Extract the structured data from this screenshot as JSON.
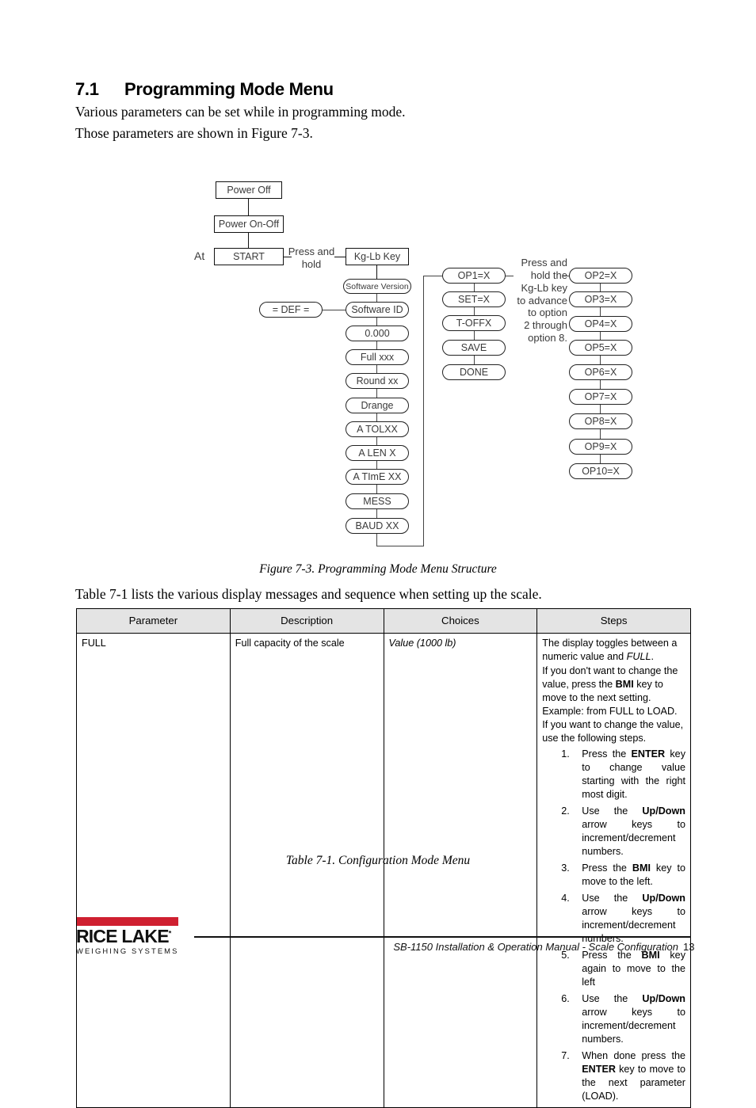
{
  "section": {
    "number": "7.1",
    "title": "Programming Mode Menu",
    "intro_line1": "Various parameters can be set while in programming mode.",
    "intro_line2": "Those parameters are shown in Figure 7-3."
  },
  "figure": {
    "caption": "Figure 7-3. Programming Mode Menu Structure",
    "at_label": "At",
    "column1": [
      {
        "label": "Power Off"
      },
      {
        "label": "Power On-Off"
      },
      {
        "label": "START"
      }
    ],
    "annotation_press_hold": "Press and\nhold",
    "annotation_kglb": "Press and\nhold the\nKg-Lb key\nto advance\nto option\n2 through\noption 8.",
    "kg_lb_key": "Kg-Lb Key",
    "def_node": "= DEF =",
    "column2": [
      {
        "label": "Software Version"
      },
      {
        "label": "Software ID"
      },
      {
        "label": "0.000"
      },
      {
        "label": "Full xxx"
      },
      {
        "label": "Round xx"
      },
      {
        "label": "Drange"
      },
      {
        "label": "A TOLXX"
      },
      {
        "label": "A LEN X"
      },
      {
        "label": "A TImE XX"
      },
      {
        "label": "MESS"
      },
      {
        "label": "BAUD XX"
      }
    ],
    "column3": [
      {
        "label": "OP1=X"
      },
      {
        "label": "SET=X"
      },
      {
        "label": "T-OFFX"
      },
      {
        "label": "SAVE"
      },
      {
        "label": "DONE"
      }
    ],
    "column4": [
      {
        "label": "OP2=X"
      },
      {
        "label": "OP3=X"
      },
      {
        "label": "OP4=X"
      },
      {
        "label": "OP5=X"
      },
      {
        "label": "OP6=X"
      },
      {
        "label": "OP7=X"
      },
      {
        "label": "OP8=X"
      },
      {
        "label": "OP9=X"
      },
      {
        "label": "OP10=X"
      }
    ]
  },
  "table_intro": "Table 7-1 lists the various display messages and sequence when setting up the scale.",
  "table": {
    "caption": "Table 7-1. Configuration Mode Menu",
    "headers": [
      "Parameter",
      "Description",
      "Choices",
      "Steps"
    ],
    "rows": [
      {
        "parameter": "FULL",
        "description": "Full capacity of the scale",
        "choices": "Value (1000 lb)",
        "steps_intro": [
          "The display toggles between a numeric value and FULL.",
          "If you don't want to change the value, press the BMI key to move to the next setting. Example: from FULL to LOAD. If you want to change the value, use the following steps."
        ],
        "steps": [
          "Press the ENTER key to change value starting with the right most digit.",
          "Use the Up/Down arrow keys to increment/decrement numbers.",
          "Press the BMI key to move to the left.",
          "Use the Up/Down arrow keys to increment/decrement numbers.",
          "Press the BMI key again to move to the left",
          "Use the Up/Down arrow keys to increment/decrement numbers.",
          "When done press the ENTER key to move to the next parameter (LOAD)."
        ]
      }
    ]
  },
  "footer": {
    "logo_name": "RICE LAKE",
    "logo_sub": "WEIGHING SYSTEMS",
    "text": "SB-1150 Installation & Operation Manual - Scale Configuration",
    "page": "13",
    "accent_color": "#cf2030"
  }
}
